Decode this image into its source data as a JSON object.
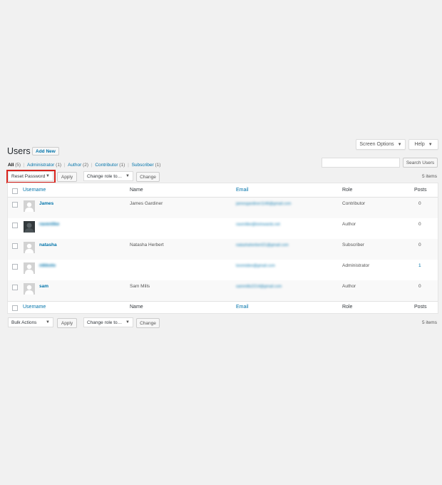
{
  "header": {
    "screen_options_label": "Screen Options",
    "help_label": "Help"
  },
  "page": {
    "title": "Users",
    "add_new_label": "Add New"
  },
  "filters": [
    {
      "label": "All",
      "count": "(5)"
    },
    {
      "label": "Administrator",
      "count": "(1)"
    },
    {
      "label": "Author",
      "count": "(2)"
    },
    {
      "label": "Contributor",
      "count": "(1)"
    },
    {
      "label": "Subscriber",
      "count": "(1)"
    }
  ],
  "search": {
    "button_label": "Search Users"
  },
  "top_nav": {
    "bulk_action_selected": "Reset Password",
    "apply_label": "Apply",
    "role_select": "Change role to…",
    "change_label": "Change",
    "items_count": "5 items"
  },
  "bottom_nav": {
    "bulk_action_selected": "Bulk Actions",
    "apply_label": "Apply",
    "role_select": "Change role to…",
    "change_label": "Change",
    "items_count": "5 items"
  },
  "table": {
    "columns": {
      "username": "Username",
      "name": "Name",
      "email": "Email",
      "role": "Role",
      "posts": "Posts"
    },
    "rows": [
      {
        "username": "James",
        "name": "James Gardiner",
        "email": "jamesgardiner1146@gmail.com",
        "role": "Contributor",
        "posts": "0"
      },
      {
        "username": "ravenlike",
        "name": "",
        "email": "ravenlike@lorinwards.net",
        "role": "Author",
        "posts": "0"
      },
      {
        "username": "natasha",
        "name": "Natasha Herbert",
        "email": "natashaherbert21@gmail.com",
        "role": "Subscriber",
        "posts": "0"
      },
      {
        "username": "nikkoto",
        "name": "",
        "email": "loremidee@gmail.com",
        "role": "Administrator",
        "posts": "1"
      },
      {
        "username": "sam",
        "name": "Sam Mills",
        "email": "sammills2214@gmail.com",
        "role": "Author",
        "posts": "0"
      }
    ]
  }
}
